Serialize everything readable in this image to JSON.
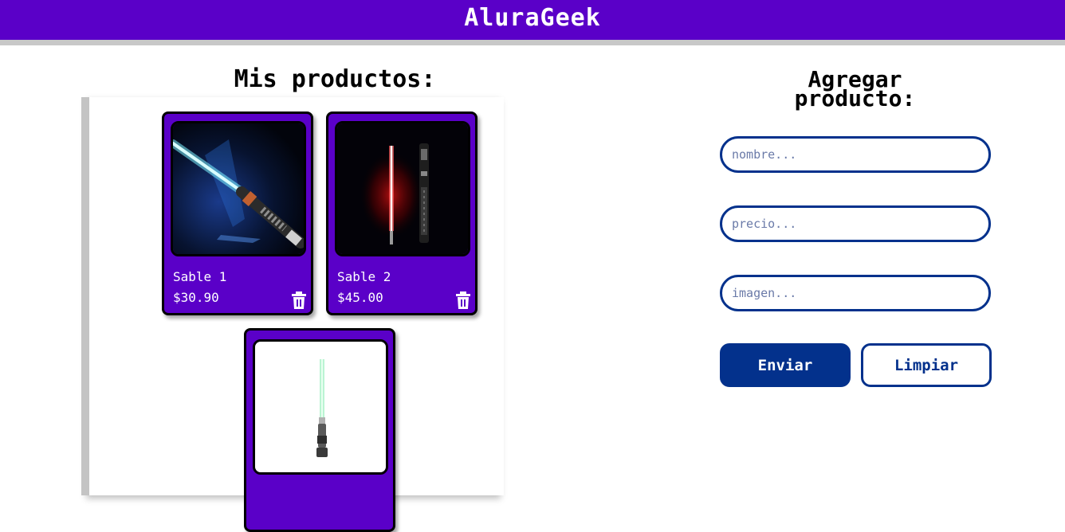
{
  "header": {
    "brand": "AluraGeek"
  },
  "products_section": {
    "title": "Mis productos:",
    "products": [
      {
        "name": "Sable 1",
        "price": "$30.90",
        "image": "blue-lightsaber"
      },
      {
        "name": "Sable 2",
        "price": "$45.00",
        "image": "red-lightsaber"
      },
      {
        "name": "",
        "price": "",
        "image": "green-lightsaber"
      }
    ],
    "delete_icon": "trash-icon"
  },
  "form": {
    "title_line1": "Agregar",
    "title_line2": "producto:",
    "name_placeholder": "nombre...",
    "price_placeholder": "precio...",
    "image_placeholder": "imagen...",
    "submit_label": "Enviar",
    "clear_label": "Limpiar"
  },
  "colors": {
    "brand_purple": "#5a00c8",
    "form_blue": "#03318c",
    "header_underline": "#c8c8c8"
  }
}
